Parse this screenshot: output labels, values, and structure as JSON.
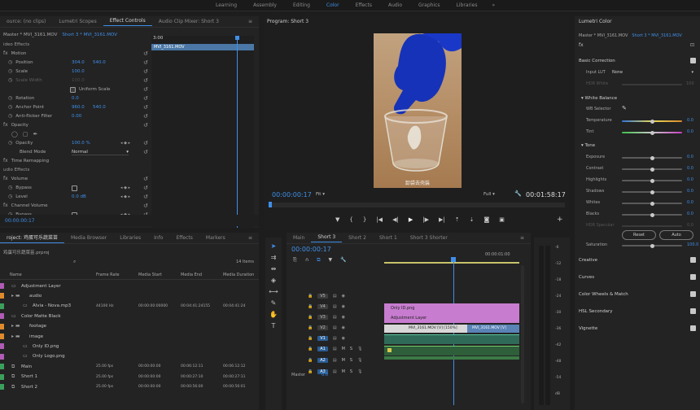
{
  "workspaces": {
    "items": [
      "Learning",
      "Assembly",
      "Editing",
      "Color",
      "Effects",
      "Audio",
      "Graphics",
      "Libraries"
    ],
    "active": "Color",
    "more_label": "»"
  },
  "effect_panel": {
    "tabs": [
      "ource: (no clips)",
      "Lumetri Scopes",
      "Effect Controls",
      "Audio Clip Mixer: Short 3"
    ],
    "active_tab": "Effect Controls",
    "master": "Master * MVI_3161.MOV",
    "clip": "Short 3 * MVI_3161.MOV",
    "timecode_top": "3:00",
    "clip_bar_label": "MVI_3161.MOV",
    "rows": {
      "video_effects": "ideo Effects",
      "motion": "Motion",
      "position": "Position",
      "position_x": "304.0",
      "position_y": "540.0",
      "scale": "Scale",
      "scale_val": "100.0",
      "scale_width": "Scale Width",
      "scale_width_val": "100.0",
      "uniform_scale": "Uniform Scale",
      "rotation": "Rotation",
      "rotation_val": "0.0",
      "anchor": "Anchor Point",
      "anchor_x": "960.0",
      "anchor_y": "540.0",
      "antiflicker": "Anti-flicker Filter",
      "antiflicker_val": "0.00",
      "opacity_group": "Opacity",
      "opacity": "Opacity",
      "opacity_val": "100.0 %",
      "blend": "Blend Mode",
      "blend_val": "Normal",
      "time_remap": "Time Remapping",
      "audio_effects": "udio Effects",
      "volume": "Volume",
      "bypass": "Bypass",
      "level": "Level",
      "level_val": "0.0 dB",
      "channel_volume": "Channel Volume",
      "bypass2": "Bypass"
    },
    "bottom_timecode": "00:00:00:17"
  },
  "program": {
    "title": "Program: Short 3",
    "timecode": "00:00:00:17",
    "fit": "Fit",
    "quality": "Full",
    "duration": "00:01:58:17",
    "subtitle": "卸袋去壳装"
  },
  "lumetri": {
    "title": "Lumetri Color",
    "master": "Master * MVI_3161.MOV",
    "clip": "Short 3 * MVI_3161.MOV",
    "basic_correction": "Basic Correction",
    "input_lut": "Input LUT",
    "input_lut_val": "None",
    "hdr_white": "HDR White",
    "hdr_white_val": "100",
    "white_balance": "White Balance",
    "wb_selector": "WB Selector",
    "temperature": "Temperature",
    "temperature_val": "0.0",
    "tint": "Tint",
    "tint_val": "0.0",
    "tone": "Tone",
    "exposure": "Exposure",
    "exposure_val": "0.0",
    "contrast": "Contrast",
    "contrast_val": "0.0",
    "highlights": "Highlights",
    "highlights_val": "0.0",
    "shadows": "Shadows",
    "shadows_val": "0.0",
    "whites": "Whites",
    "whites_val": "0.0",
    "blacks": "Blacks",
    "blacks_val": "0.0",
    "hdr_specular": "HDR Specular",
    "hdr_specular_val": "0.0",
    "reset": "Reset",
    "auto": "Auto",
    "saturation": "Saturation",
    "saturation_val": "100.0",
    "sections": [
      "Creative",
      "Curves",
      "Color Wheels & Match",
      "HSL Secondary",
      "Vignette"
    ]
  },
  "project": {
    "tabs": [
      "roject: 鸡蛋可乐蔬菜苗",
      "Media Browser",
      "Libraries",
      "Info",
      "Effects",
      "Markers"
    ],
    "active_tab": "roject: 鸡蛋可乐蔬菜苗",
    "project_file": "鸡蛋可乐蔬菜苗.prproj",
    "items_count": "14 Items",
    "columns": [
      "Name",
      "Frame Rate",
      "Media Start",
      "Media End",
      "Media Duration"
    ],
    "rows": [
      {
        "name": "Adjustment Layer",
        "fps": "",
        "start": "",
        "end": "",
        "dur": "",
        "color": "#b05bb5",
        "indent": 1,
        "kind": "file"
      },
      {
        "name": "audio",
        "fps": "",
        "start": "",
        "end": "",
        "dur": "",
        "color": "#e08a2b",
        "indent": 1,
        "kind": "folder"
      },
      {
        "name": "Alvia - Nova.mp3",
        "fps": "44100 Hz",
        "start": "00:00:00:00000",
        "end": "00:04:41:24155",
        "dur": "00:04:41:24",
        "color": "#3aa05c",
        "indent": 2,
        "kind": "file"
      },
      {
        "name": "Color Matte Black",
        "fps": "",
        "start": "",
        "end": "",
        "dur": "",
        "color": "#b05bb5",
        "indent": 1,
        "kind": "file"
      },
      {
        "name": "footage",
        "fps": "",
        "start": "",
        "end": "",
        "dur": "",
        "color": "#e08a2b",
        "indent": 1,
        "kind": "folder"
      },
      {
        "name": "image",
        "fps": "",
        "start": "",
        "end": "",
        "dur": "",
        "color": "#e08a2b",
        "indent": 1,
        "kind": "folder"
      },
      {
        "name": "Only ID.png",
        "fps": "",
        "start": "",
        "end": "",
        "dur": "",
        "color": "#b05bb5",
        "indent": 2,
        "kind": "file"
      },
      {
        "name": "Only Logo.png",
        "fps": "",
        "start": "",
        "end": "",
        "dur": "",
        "color": "#b05bb5",
        "indent": 2,
        "kind": "file"
      },
      {
        "name": "Main",
        "fps": "25.00 fps",
        "start": "00:00:00:00",
        "end": "00:06:12:11",
        "dur": "00:06:12:12",
        "color": "#3aa05c",
        "indent": 1,
        "kind": "seq"
      },
      {
        "name": "Short 1",
        "fps": "25.00 fps",
        "start": "00:00:00:00",
        "end": "00:00:27:10",
        "dur": "00:00:27:11",
        "color": "#3aa05c",
        "indent": 1,
        "kind": "seq"
      },
      {
        "name": "Short 2",
        "fps": "25.00 fps",
        "start": "00:00:00:00",
        "end": "00:00:56:00",
        "dur": "00:00:56:01",
        "color": "#3aa05c",
        "indent": 1,
        "kind": "seq"
      }
    ]
  },
  "timeline": {
    "tabs": [
      "Main",
      "Short 3",
      "Short 2",
      "Short 1",
      "Short 3 Shorter"
    ],
    "active_tab": "Short 3",
    "timecode": "00:00:00:17",
    "ruler_time": "00:00:01:00",
    "tracks": [
      "V5",
      "V4",
      "V3",
      "V2",
      "V1",
      "A1",
      "A2",
      "A3"
    ],
    "master": "Master",
    "master_val": "0.0",
    "clips": {
      "only_id": "Only ID.png",
      "adjustment": "Adjustment Layer",
      "clip_a": "MVI_3161.MOV [V] [150%]",
      "clip_b": "MVI_3161.MOV [V]"
    }
  },
  "meter": {
    "labels": [
      "-6",
      "-12",
      "-18",
      "-24",
      "-30",
      "-36",
      "-42",
      "-48",
      "-54",
      "dB"
    ]
  }
}
